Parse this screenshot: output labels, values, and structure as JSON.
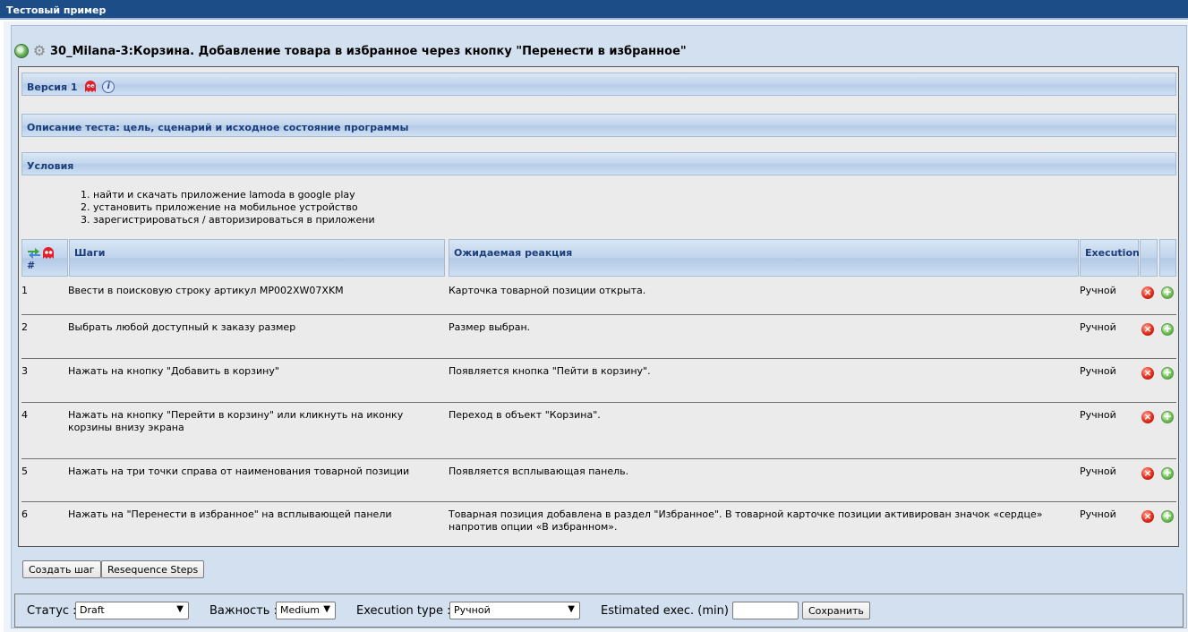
{
  "window": {
    "title": "Тестовый пример"
  },
  "testcase": {
    "title": "30_Milana-3:Корзина. Добавление товара в избранное через кнопку \"Перенести в избранное\""
  },
  "sections": {
    "version": "Версия 1",
    "description": "Описание теста: цель, сценарий и исходное состояние программы",
    "conditions": "Условия"
  },
  "conditions_list": [
    "найти и скачать приложение lamoda  в google play",
    "установить приложение на мобильное устройство",
    "зарегистрироваться / авторизироваться в приложени"
  ],
  "table": {
    "headers": {
      "num": "#",
      "steps": "Шаги",
      "expected": "Ожидаемая реакция",
      "execution": "Execution"
    },
    "rows": [
      {
        "num": "1",
        "step": "Ввести в поисковую строку артикул MP002XW07XKM",
        "expected": "Карточка товарной позиции открыта.",
        "execution": "Ручной"
      },
      {
        "num": "2",
        "step": "Выбрать любой доступный к заказу размер",
        "expected": "Размер выбран.",
        "execution": "Ручной"
      },
      {
        "num": "3",
        "step": "Нажать на кнопку \"Добавить в корзину\"",
        "expected": "Появляется кнопка \"Пейти в корзину\".",
        "execution": "Ручной"
      },
      {
        "num": "4",
        "step": "Нажать на кнопку \"Перейти в корзину\" или кликнуть на иконку корзины внизу экрана",
        "expected": "Переход в объект \"Корзина\".",
        "execution": "Ручной"
      },
      {
        "num": "5",
        "step": "Нажать на три точки справа от наименования товарной позиции",
        "expected": "Появляется всплывающая панель.",
        "execution": "Ручной"
      },
      {
        "num": "6",
        "step": "Нажать на \"Перенести в избранное\" на всплывающей панели",
        "expected": "Товарная позиция добавлена в раздел \"Избранное\". В товарной карточке позиции активирован значок «сердце» напротив опции «В избранном».",
        "execution": "Ручной"
      }
    ]
  },
  "buttons": {
    "create_step": "Создать шаг",
    "resequence": "Resequence Steps",
    "save": "Сохранить"
  },
  "footer": {
    "status_label": "Статус :",
    "status_value": "Draft",
    "importance_label": "Важность :",
    "importance_value": "Medium",
    "exec_type_label": "Execution type :",
    "exec_type_value": "Ручной",
    "estimated_label": "Estimated exec. (min) :",
    "estimated_value": ""
  },
  "icons": {
    "execute": "execute-icon",
    "settings": "gear-icon",
    "ghost": "ghost-icon",
    "info": "info-icon",
    "reorder": "reorder-icon",
    "delete": "delete-icon",
    "add": "add-icon"
  },
  "colors": {
    "topbar": "#1d4d86",
    "section_text": "#1b3d7a",
    "panel": "#d2e0ef",
    "box": "#ebebeb"
  }
}
